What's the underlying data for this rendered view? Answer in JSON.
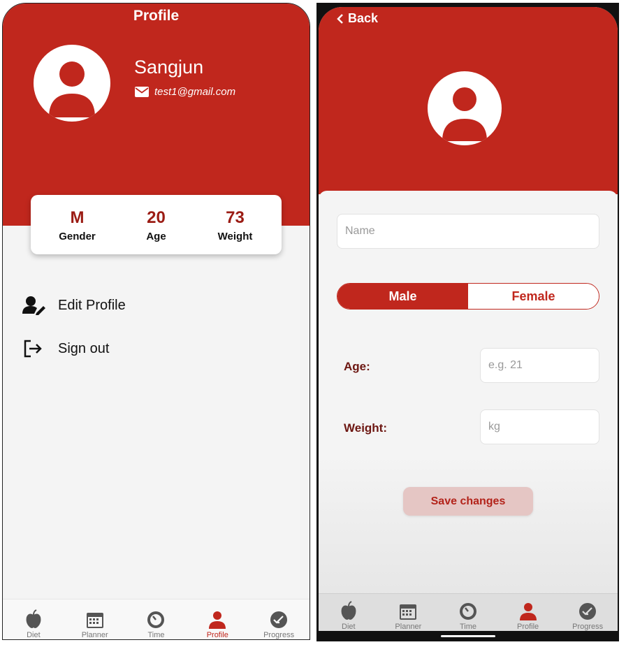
{
  "left": {
    "title": "Profile",
    "user": {
      "name": "Sangjun",
      "email": "test1@gmail.com"
    },
    "stats": [
      {
        "value": "M",
        "label": "Gender"
      },
      {
        "value": "20",
        "label": "Age"
      },
      {
        "value": "73",
        "label": "Weight"
      }
    ],
    "menu": [
      {
        "label": "Edit Profile",
        "icon": "user-edit-icon"
      },
      {
        "label": "Sign out",
        "icon": "sign-out-icon"
      }
    ]
  },
  "right": {
    "back_label": "Back",
    "name_placeholder": "Name",
    "gender_options": {
      "male": "Male",
      "female": "Female",
      "selected": "Male"
    },
    "age_label": "Age:",
    "age_placeholder": "e.g. 21",
    "weight_label": "Weight:",
    "weight_placeholder": "kg",
    "save_label": "Save changes"
  },
  "tabs": [
    {
      "label": "Diet",
      "icon": "apple-icon"
    },
    {
      "label": "Planner",
      "icon": "calendar-icon"
    },
    {
      "label": "Time",
      "icon": "timer-icon"
    },
    {
      "label": "Profile",
      "icon": "person-icon",
      "active": true
    },
    {
      "label": "Progress",
      "icon": "check-badge-icon"
    }
  ],
  "colors": {
    "brand_red": "#c0271d",
    "dark_red": "#9b1c14",
    "save_bg": "#e5c6c4"
  }
}
